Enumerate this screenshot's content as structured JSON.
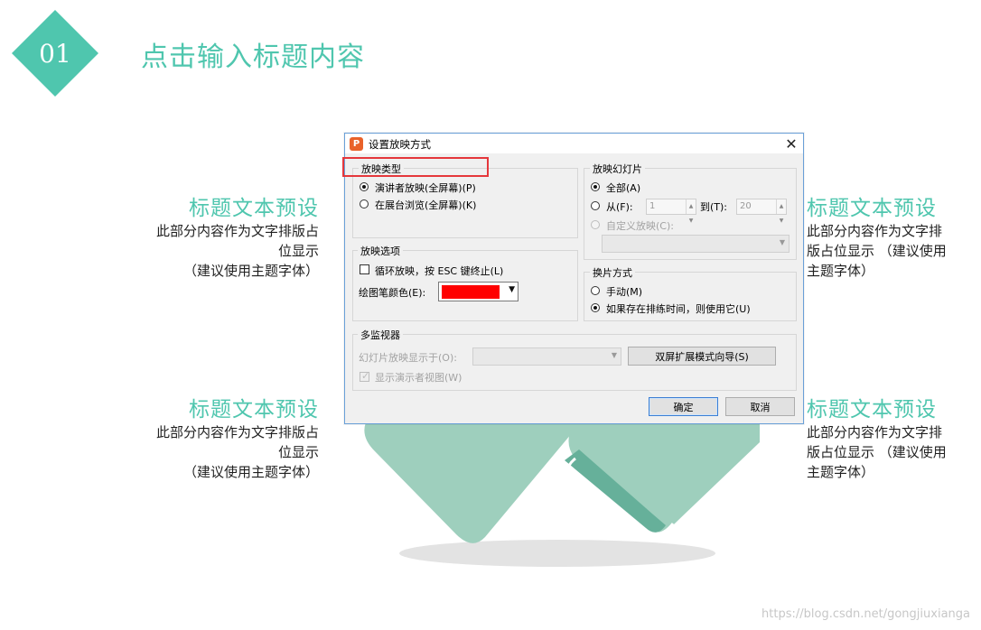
{
  "slide": {
    "badge_number": "01",
    "title": "点击输入标题内容",
    "blocks": [
      {
        "title": "标题文本预设",
        "body_lines": [
          "此部分内容作为文字排版占",
          "位显示",
          "（建议使用主题字体）"
        ]
      },
      {
        "title": "标题文本预设",
        "body_lines": [
          "此部分内容作为文字排",
          "版占位显示 （建议使用",
          "主题字体）"
        ]
      },
      {
        "title": "标题文本预设",
        "body_lines": [
          "此部分内容作为文字排版占",
          "位显示",
          "（建议使用主题字体）"
        ]
      },
      {
        "title": "标题文本预设",
        "body_lines": [
          "此部分内容作为文字排",
          "版占位显示 （建议使用",
          "主题字体）"
        ]
      }
    ],
    "watermark": "https://blog.csdn.net/gongjiuxianga",
    "colors": {
      "accent": "#4fc6ae",
      "shape_light": "#9ecfbd",
      "shape_dark": "#66b09a"
    }
  },
  "dialog": {
    "title": "设置放映方式",
    "close_icon": "close-icon",
    "show_type": {
      "label": "放映类型",
      "options": [
        {
          "label": "演讲者放映(全屏幕)(P)",
          "selected": true
        },
        {
          "label": "在展台浏览(全屏幕)(K)",
          "selected": false
        }
      ]
    },
    "show_options": {
      "label": "放映选项",
      "loop_label": "循环放映，按 ESC 键终止(L)",
      "loop_checked": false,
      "pen_color_label": "绘图笔颜色(E):",
      "pen_color": "#ff0000"
    },
    "slides": {
      "label": "放映幻灯片",
      "all_label": "全部(A)",
      "all_selected": true,
      "from_label": "从(F):",
      "from_value": "1",
      "to_label": "到(T):",
      "to_value": "20",
      "custom_label": "自定义放映(C):"
    },
    "advance": {
      "label": "换片方式",
      "options": [
        {
          "label": "手动(M)",
          "selected": false
        },
        {
          "label": "如果存在排练时间，则使用它(U)",
          "selected": true
        }
      ]
    },
    "monitors": {
      "label": "多监视器",
      "display_on_label": "幻灯片放映显示于(O):",
      "dual_screen_button": "双屏扩展模式向导(S)",
      "presenter_view_label": "显示演示者视图(W)",
      "presenter_view_checked": true
    },
    "ok_label": "确定",
    "cancel_label": "取消",
    "highlight_color": "#e5373b"
  }
}
